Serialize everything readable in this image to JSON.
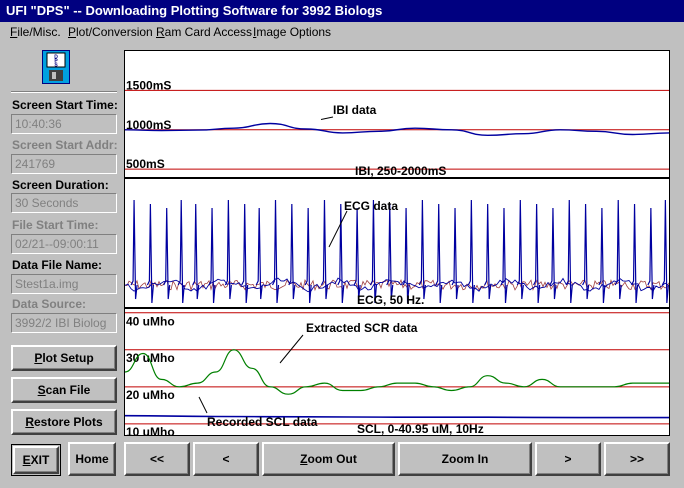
{
  "window": {
    "title": "UFI \"DPS\" -- Downloading Plotting Software for 3992 Biologs"
  },
  "menu": [
    {
      "label": "File/Misc."
    },
    {
      "label": "Plot/Conversion"
    },
    {
      "label": "Ram Card Access"
    },
    {
      "label": "Image Options"
    }
  ],
  "sidebar": {
    "screen_start_time": {
      "label": "Screen Start Time:",
      "value": "10:40:36"
    },
    "screen_start_addr": {
      "label": "Screen Start Addr:",
      "value": "241769"
    },
    "screen_duration": {
      "label": "Screen Duration:",
      "value": "30 Seconds"
    },
    "file_start_time": {
      "label": "File Start Time:",
      "value": "02/21--09:00:11"
    },
    "data_file_name": {
      "label": "Data File Name:",
      "value": "Stest1a.img"
    },
    "data_source": {
      "label": "Data Source:",
      "value": "3992/2 IBI Biolog"
    }
  },
  "buttons": {
    "plot_setup": "Plot Setup",
    "scan_file": "Scan File",
    "restore_plots": "Restore Plots",
    "exit": "EXIT",
    "home": "Home",
    "rewind": "<<",
    "back": "<",
    "zoom_out": "Zoom Out",
    "zoom_in": "Zoom In",
    "forward": ">",
    "fast_forward": ">>"
  },
  "logo": {
    "icon": "floppy-disk-icon",
    "text": "DPS"
  },
  "colors": {
    "trace": "#0000a0",
    "gridline": "#c00000",
    "scr_trace": "#008000"
  },
  "chart_data": [
    {
      "type": "line",
      "title": "IBI, 250-2000mS",
      "annotation": "IBI data",
      "ytick_labels": [
        "1500mS",
        "1000mS",
        "500mS"
      ],
      "yticks": [
        1500,
        1000,
        500
      ],
      "ylim": [
        400,
        2000
      ],
      "series": [
        {
          "name": "IBI data",
          "x": [
            0,
            2,
            4,
            6,
            8,
            10,
            12,
            14,
            16,
            18,
            20,
            22,
            24,
            26,
            28,
            30
          ],
          "values": [
            1000,
            990,
            995,
            1020,
            1080,
            1010,
            960,
            980,
            1020,
            1000,
            930,
            950,
            1000,
            980,
            940,
            960
          ]
        }
      ]
    },
    {
      "type": "line",
      "title": "ECG, 50 Hz.",
      "annotation": "ECG data",
      "xlim": [
        0,
        30
      ],
      "beats": [
        0.5,
        1.4,
        2.3,
        3.1,
        3.9,
        4.8,
        5.7,
        6.6,
        7.4,
        8.3,
        9.2,
        10.1,
        11.0,
        11.9,
        12.8,
        13.7,
        14.6,
        15.5,
        16.4,
        17.3,
        18.2,
        19.1,
        20.0,
        20.9,
        21.8,
        22.7,
        23.6,
        24.5,
        25.4,
        26.3,
        27.2,
        28.1,
        29.0,
        29.8
      ],
      "ylim": [
        -1,
        1
      ]
    },
    {
      "type": "line",
      "title": "SCL, 0-40.95 uM, 10Hz",
      "annotations": [
        "Extracted SCR data",
        "Recorded SCL data"
      ],
      "ytick_labels": [
        "40 uMho",
        "30 uMho",
        "20 uMho",
        "10 uMho"
      ],
      "yticks": [
        40,
        30,
        20,
        10
      ],
      "ylim": [
        7,
        41
      ],
      "series": [
        {
          "name": "Extracted SCR data",
          "x": [
            0,
            1,
            2,
            3,
            4,
            5,
            6,
            7,
            8,
            9,
            10,
            11,
            12,
            13,
            14,
            15,
            16,
            17,
            18,
            19,
            20,
            21,
            22,
            23,
            24,
            25,
            26,
            27,
            28,
            29,
            30
          ],
          "values": [
            24,
            29,
            22,
            20,
            21,
            24,
            30,
            25,
            20,
            18,
            20,
            21,
            19,
            19,
            20,
            21,
            21,
            20,
            19,
            20,
            23,
            21,
            20,
            22,
            20,
            20,
            20,
            20,
            21,
            21,
            21
          ]
        },
        {
          "name": "Recorded SCL data",
          "x": [
            0,
            5,
            10,
            15,
            20,
            25,
            30
          ],
          "values": [
            12.2,
            12.0,
            11.9,
            11.8,
            11.8,
            11.7,
            11.7
          ]
        }
      ]
    }
  ]
}
